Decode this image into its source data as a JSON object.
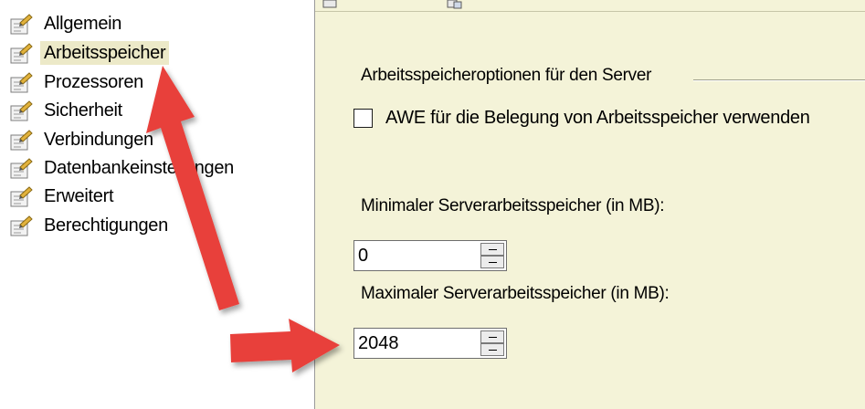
{
  "nav": {
    "items": [
      {
        "label": "Allgemein",
        "icon": "properties-page-icon",
        "selected": false
      },
      {
        "label": "Arbeitsspeicher",
        "icon": "properties-page-icon",
        "selected": true
      },
      {
        "label": "Prozessoren",
        "icon": "properties-page-icon",
        "selected": false
      },
      {
        "label": "Sicherheit",
        "icon": "properties-page-icon",
        "selected": false
      },
      {
        "label": "Verbindungen",
        "icon": "properties-page-icon",
        "selected": false
      },
      {
        "label": "Datenbankeinstellungen",
        "icon": "properties-page-icon",
        "selected": false
      },
      {
        "label": "Erweitert",
        "icon": "properties-page-icon",
        "selected": false
      },
      {
        "label": "Berechtigungen",
        "icon": "properties-page-icon",
        "selected": false
      }
    ]
  },
  "panel": {
    "group_title": "Arbeitsspeicheroptionen für den Server",
    "awe_checkbox": {
      "label": "AWE für die Belegung von Arbeitsspeicher verwenden",
      "checked": false
    },
    "min_memory": {
      "label": "Minimaler Serverarbeitsspeicher (in MB):",
      "value": "0"
    },
    "max_memory": {
      "label": "Maximaler Serverarbeitsspeicher (in MB):",
      "value": "2048"
    }
  },
  "colors": {
    "panel_background": "#f4f3d8",
    "selection_highlight": "#ece9c8",
    "annotation_arrow": "#e8403a"
  },
  "annotations": {
    "arrows": [
      "red-arrow-to-arbeitsspeicher",
      "red-arrow-to-max-memory"
    ]
  }
}
